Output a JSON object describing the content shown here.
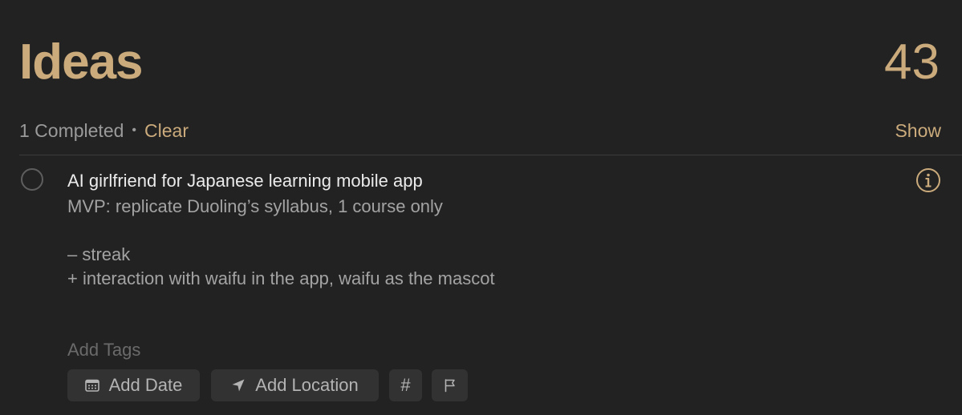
{
  "list": {
    "title": "Ideas",
    "count": "43",
    "accent_color": "#cbab7c"
  },
  "completed_bar": {
    "completed_text": "1 Completed",
    "separator": "•",
    "clear_label": "Clear",
    "show_label": "Show"
  },
  "reminder": {
    "title": "AI girlfriend for Japanese learning mobile app",
    "notes": "MVP: replicate Duoling’s syllabus, 1 course only\n\n– streak\n+ interaction with waifu in the app, waifu as the mascot",
    "completed": false,
    "info_icon": "info-circle-icon"
  },
  "editor": {
    "tags_placeholder": "Add Tags",
    "add_date_label": "Add Date",
    "add_location_label": "Add Location",
    "tag_symbol": "#",
    "icons": {
      "date": "calendar-icon",
      "location": "location-arrow-icon",
      "flag": "flag-icon"
    }
  }
}
